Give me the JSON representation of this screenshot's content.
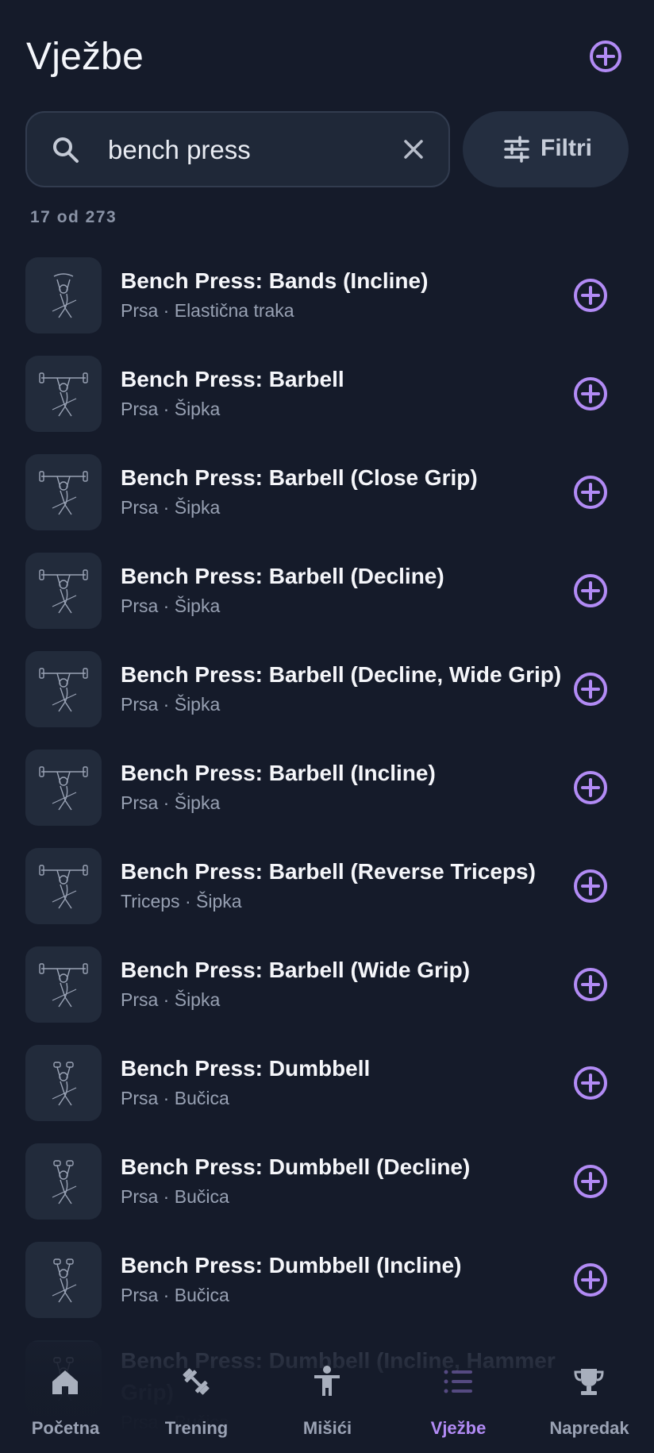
{
  "header": {
    "title": "Vježbe"
  },
  "search": {
    "value": "bench press"
  },
  "filter": {
    "label": "Filtri"
  },
  "results": {
    "count_text": "17 od 273"
  },
  "exercises": [
    {
      "title": "Bench Press: Bands (Incline)",
      "subtitle": "Prsa · Elastična traka",
      "icon": "incline-bands-figure-icon"
    },
    {
      "title": "Bench Press: Barbell",
      "subtitle": "Prsa · Šipka",
      "icon": "barbell-bench-figure-icon"
    },
    {
      "title": "Bench Press: Barbell (Close Grip)",
      "subtitle": "Prsa · Šipka",
      "icon": "barbell-bench-figure-icon"
    },
    {
      "title": "Bench Press: Barbell (Decline)",
      "subtitle": "Prsa · Šipka",
      "icon": "barbell-decline-figure-icon"
    },
    {
      "title": "Bench Press: Barbell (Decline, Wide Grip)",
      "subtitle": "Prsa · Šipka",
      "icon": "barbell-decline-figure-icon"
    },
    {
      "title": "Bench Press: Barbell (Incline)",
      "subtitle": "Prsa · Šipka",
      "icon": "barbell-incline-figure-icon"
    },
    {
      "title": "Bench Press: Barbell (Reverse Triceps)",
      "subtitle": "Triceps · Šipka",
      "icon": "barbell-incline-figure-icon"
    },
    {
      "title": "Bench Press: Barbell (Wide Grip)",
      "subtitle": "Prsa · Šipka",
      "icon": "barbell-bench-figure-icon"
    },
    {
      "title": "Bench Press: Dumbbell",
      "subtitle": "Prsa · Bučica",
      "icon": "dumbbell-figure-icon"
    },
    {
      "title": "Bench Press: Dumbbell (Decline)",
      "subtitle": "Prsa · Bučica",
      "icon": "dumbbell-decline-figure-icon"
    },
    {
      "title": "Bench Press: Dumbbell (Incline)",
      "subtitle": "Prsa · Bučica",
      "icon": "dumbbell-figure-icon"
    },
    {
      "title": "Bench Press: Dumbbell (Incline, Hammer Grip)",
      "subtitle": "Prsa · Bučica",
      "icon": "dumbbell-figure-icon"
    }
  ],
  "nav": [
    {
      "label": "Početna",
      "icon": "home-icon",
      "active": false
    },
    {
      "label": "Trening",
      "icon": "dumbbell-icon",
      "active": false
    },
    {
      "label": "Mišići",
      "icon": "person-icon",
      "active": false
    },
    {
      "label": "Vježbe",
      "icon": "list-icon",
      "active": true
    },
    {
      "label": "Napredak",
      "icon": "trophy-icon",
      "active": false
    }
  ],
  "colors": {
    "background": "#151b2a",
    "accent": "#b28bf5",
    "surface": "#1f2838",
    "text_secondary": "#98a1b3"
  }
}
